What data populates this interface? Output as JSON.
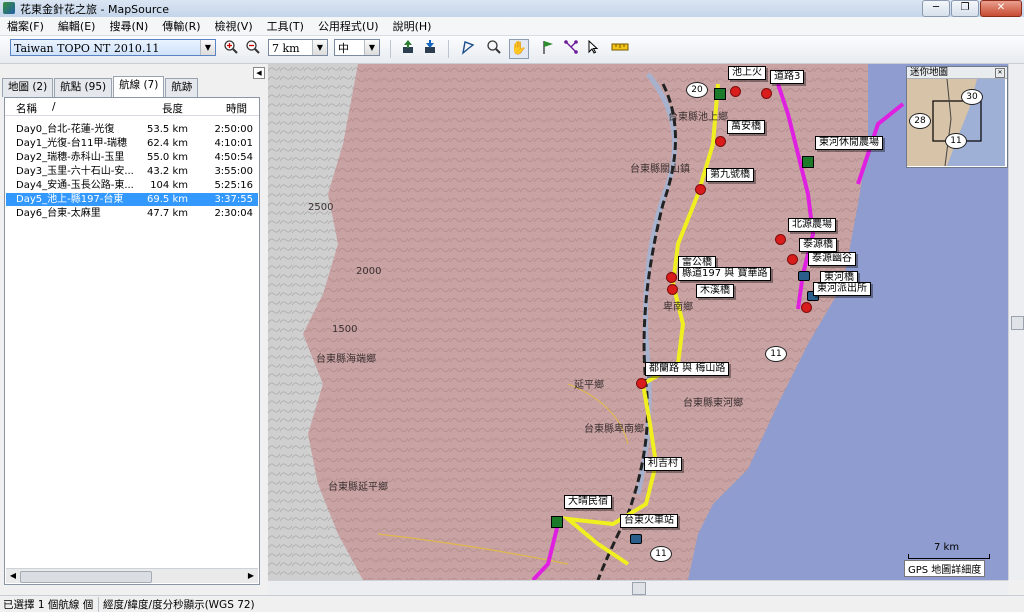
{
  "window": {
    "title": "花東金針花之旅 - MapSource",
    "controls": [
      "─",
      "❐",
      "✕"
    ]
  },
  "menu": [
    "檔案(F)",
    "編輯(E)",
    "搜尋(N)",
    "傳輸(R)",
    "檢視(V)",
    "工具(T)",
    "公用程式(U)",
    "說明(H)"
  ],
  "toolbar": {
    "product": "Taiwan TOPO NT 2010.11",
    "zoom": "7 km",
    "detail": "中"
  },
  "tabs": [
    "地圖 (2)",
    "航點 (95)",
    "航線 (7)",
    "航跡"
  ],
  "routes": {
    "headers": [
      "名稱",
      "/",
      "長度",
      "時間"
    ],
    "rows": [
      {
        "name": "Day0_台北-花蓮-光復",
        "length": "53.5 km",
        "time": "2:50:00"
      },
      {
        "name": "Day1_光復-台11甲-瑞穗",
        "length": "62.4 km",
        "time": "4:10:01"
      },
      {
        "name": "Day2_瑞穗-赤科山-玉里",
        "length": "55.0 km",
        "time": "4:50:54"
      },
      {
        "name": "Day3_玉里-六十石山-安...",
        "length": "43.2 km",
        "time": "3:55:00"
      },
      {
        "name": "Day4_安通-玉長公路-東...",
        "length": "104 km",
        "time": "5:25:16"
      },
      {
        "name": "Day5_池上-縣197-台東",
        "length": "69.5 km",
        "time": "3:37:55"
      },
      {
        "name": "Day6_台東-太麻里",
        "length": "47.7 km",
        "time": "2:30:04"
      }
    ],
    "selected_index": 5
  },
  "map": {
    "labels": [
      "池上火",
      "道路3",
      "萬安橋",
      "東河休閒農場",
      "第九號橋",
      "北源農場",
      "泰源橋",
      "泰源幽谷",
      "雷公橋",
      "縣道197 與 寶華路",
      "木溪橋",
      "東河橋",
      "東河派出所",
      "都蘭路 與 梅山路",
      "利吉村",
      "大晴民宿",
      "台東火車站"
    ],
    "place_names": [
      "台東縣關山鎮",
      "台東縣池上鄉",
      "台東縣東河鄉",
      "台東縣卑南鄉",
      "台東縣延平鄉",
      "台東縣海端鄉",
      "延平鄉",
      "卑南鄉"
    ],
    "contours": [
      "2500",
      "2000",
      "1500"
    ],
    "shields": [
      "20",
      "11",
      "11"
    ],
    "minimap_title": "迷你地圖",
    "minimap_shields": [
      "30",
      "28",
      "11"
    ],
    "scale": "7 km",
    "gps_note": "GPS 地圖詳細度"
  },
  "status": {
    "selection": "已選擇 1 個航線 個",
    "coords": "經度/緯度/度分秒顯示(WGS 72)"
  },
  "colors": {
    "terrain": "#c9a3a4",
    "sea": "#8f9ccf",
    "route_selected": "#f0f020",
    "route_other": "#e020e0",
    "pin": "#d91c1c",
    "selection": "#3399ff"
  }
}
